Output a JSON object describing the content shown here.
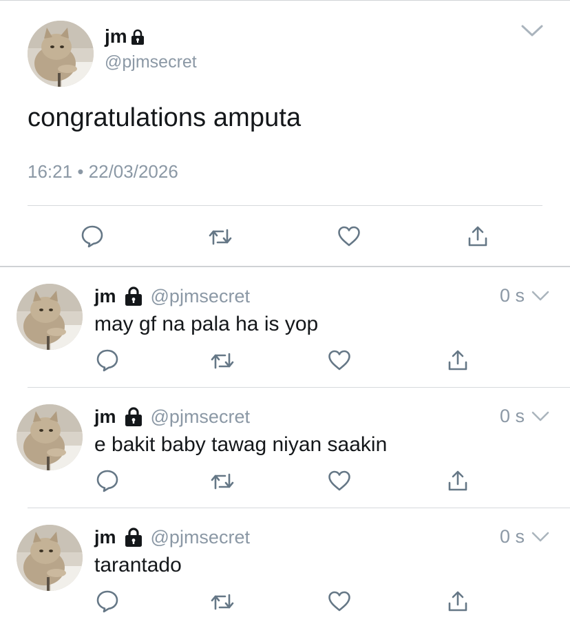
{
  "main_tweet": {
    "name": "jm",
    "handle": "@pjmsecret",
    "text": "congratulations amputa",
    "time": "16:21",
    "separator": "•",
    "date": "22/03/2026"
  },
  "replies": [
    {
      "name": "jm",
      "handle": "@pjmsecret",
      "time": "0 s",
      "text": "may gf na pala ha is yop"
    },
    {
      "name": "jm",
      "handle": "@pjmsecret",
      "time": "0 s",
      "text": "e bakit baby tawag niyan saakin"
    },
    {
      "name": "jm",
      "handle": "@pjmsecret",
      "time": "0 s",
      "text": "tarantado"
    }
  ],
  "icons": {
    "lock": "lock-icon",
    "chevron": "chevron-down-icon",
    "reply": "reply-icon",
    "retweet": "retweet-icon",
    "like": "heart-icon",
    "share": "share-icon"
  },
  "colors": {
    "text": "#14171a",
    "secondary": "#8b98a5",
    "icon": "#657786",
    "divider": "#d6d9dc"
  }
}
